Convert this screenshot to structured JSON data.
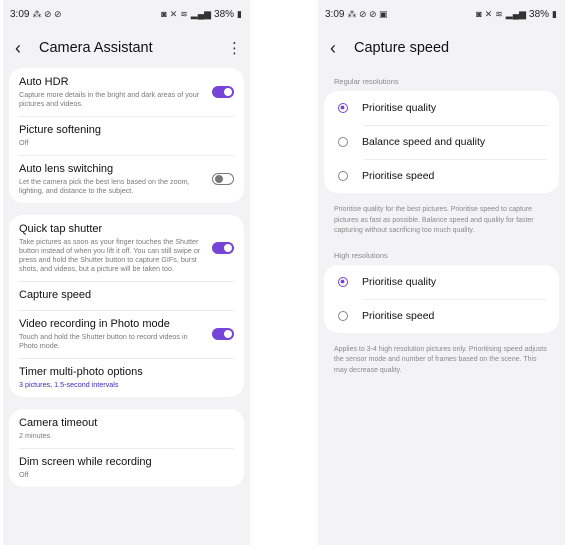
{
  "left": {
    "status": {
      "time": "3:09",
      "icons_left": "⁂ ⊘ ⊘",
      "battery": "38%"
    },
    "title": "Camera Assistant",
    "more": "⋮",
    "groups": [
      [
        {
          "title": "Auto HDR",
          "subtitle": "Capture more details in the bright and dark areas of your pictures and videos.",
          "toggle": "on"
        },
        {
          "title": "Picture softening",
          "subtitle": "Off"
        },
        {
          "title": "Auto lens switching",
          "subtitle": "Let the camera pick the best lens based on the zoom, lighting, and distance to the subject.",
          "toggle": "off"
        }
      ],
      [
        {
          "title": "Quick tap shutter",
          "subtitle": "Take pictures as soon as your finger touches the Shutter button instead of when you lift it off. You can still swipe or press and hold the Shutter button to capture GIFs, burst shots, and videos, but a picture will be taken too.",
          "toggle": "on"
        },
        {
          "title": "Capture speed"
        },
        {
          "title": "Video recording in Photo mode",
          "subtitle": "Touch and hold the Shutter button to record videos in Photo mode.",
          "toggle": "on"
        },
        {
          "title": "Timer multi-photo options",
          "subtitle": "3 pictures, 1.5-second intervals",
          "accent": true
        }
      ],
      [
        {
          "title": "Camera timeout",
          "subtitle": "2 minutes"
        },
        {
          "title": "Dim screen while recording",
          "subtitle": "Off"
        }
      ]
    ]
  },
  "right": {
    "status": {
      "time": "3:09",
      "icons_left": "⁂ ⊘ ⊘ ▣",
      "battery": "38%"
    },
    "title": "Capture speed",
    "regular": {
      "label": "Regular resolutions",
      "options": [
        {
          "label": "Prioritise quality",
          "selected": true
        },
        {
          "label": "Balance speed and quality",
          "selected": false
        },
        {
          "label": "Prioritise speed",
          "selected": false
        }
      ],
      "description": "Prioritise quality for the best pictures. Prioritise speed to capture pictures as fast as possible. Balance speed and quality for faster capturing without sacrificing too much quality."
    },
    "high": {
      "label": "High resolutions",
      "options": [
        {
          "label": "Prioritise quality",
          "selected": true
        },
        {
          "label": "Prioritise speed",
          "selected": false
        }
      ],
      "description": "Applies to 3-4 high resolution pictures only. Prioritising speed adjusts the sensor mode and number of frames based on the scene. This may decrease quality."
    }
  },
  "status_icons": {
    "alarm": "◙",
    "mute": "✕",
    "wifi": "≋",
    "signal": "▂▄▆"
  },
  "colors": {
    "accent": "#7645d8",
    "subtitle_accent": "#3b2dbf",
    "background": "#f3f3f5"
  }
}
